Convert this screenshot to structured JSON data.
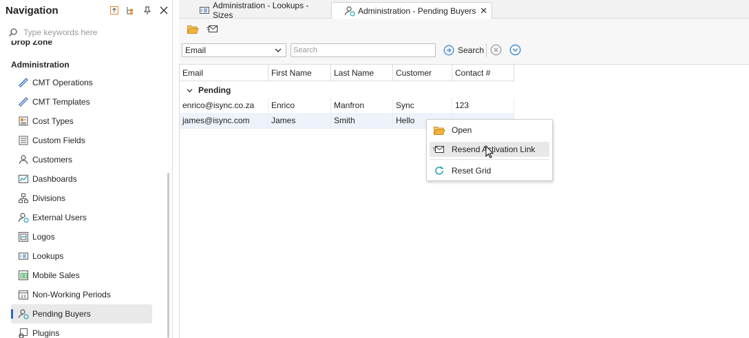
{
  "colors": {
    "accent": "#2a64c5",
    "link_blue": "#3a8bd6",
    "folder": "#e8a53c",
    "teal": "#1fa0b5"
  },
  "nav": {
    "title": "Navigation",
    "search_placeholder": "Type keywords here",
    "clipped_heading": "Drop Zone",
    "section": "Administration",
    "items": [
      {
        "label": "CMT Operations",
        "icon": "ruler-icon"
      },
      {
        "label": "CMT Templates",
        "icon": "ruler-icon"
      },
      {
        "label": "Cost Types",
        "icon": "cost-types-icon"
      },
      {
        "label": "Custom Fields",
        "icon": "custom-fields-icon"
      },
      {
        "label": "Customers",
        "icon": "person-icon"
      },
      {
        "label": "Dashboards",
        "icon": "dashboard-icon"
      },
      {
        "label": "Divisions",
        "icon": "org-chart-icon"
      },
      {
        "label": "External Users",
        "icon": "external-users-icon"
      },
      {
        "label": "Logos",
        "icon": "logo-image-icon"
      },
      {
        "label": "Lookups",
        "icon": "lookup-icon"
      },
      {
        "label": "Mobile Sales",
        "icon": "mobile-sales-icon"
      },
      {
        "label": "Non-Working Periods",
        "icon": "calendar-icon"
      },
      {
        "label": "Pending Buyers",
        "icon": "pending-buyers-icon",
        "active": true
      },
      {
        "label": "Plugins",
        "icon": "plugin-icon"
      }
    ]
  },
  "tabs": [
    {
      "label": "Administration - Lookups - Sizes",
      "icon": "lookup-icon"
    },
    {
      "label": "Administration - Pending Buyers",
      "icon": "pending-buyers-icon",
      "active": true
    }
  ],
  "search": {
    "field": "Email",
    "placeholder": "Search",
    "button": "Search"
  },
  "grid": {
    "columns": [
      "Email",
      "First Name",
      "Last Name",
      "Customer",
      "Contact #"
    ],
    "group": "Pending",
    "rows": [
      [
        "enrico@isync.co.za",
        "Enrico",
        "Manfron",
        "Sync",
        "123"
      ],
      [
        "james@isync.com",
        "James",
        "Smith",
        "Hello",
        ""
      ]
    ]
  },
  "context_menu": {
    "items": [
      {
        "label": "Open",
        "icon": "folder-open-icon"
      },
      {
        "label": "Resend Activation Link",
        "icon": "envelope-icon",
        "highlighted": true
      },
      {
        "label": "Reset Grid",
        "icon": "refresh-icon"
      }
    ]
  }
}
